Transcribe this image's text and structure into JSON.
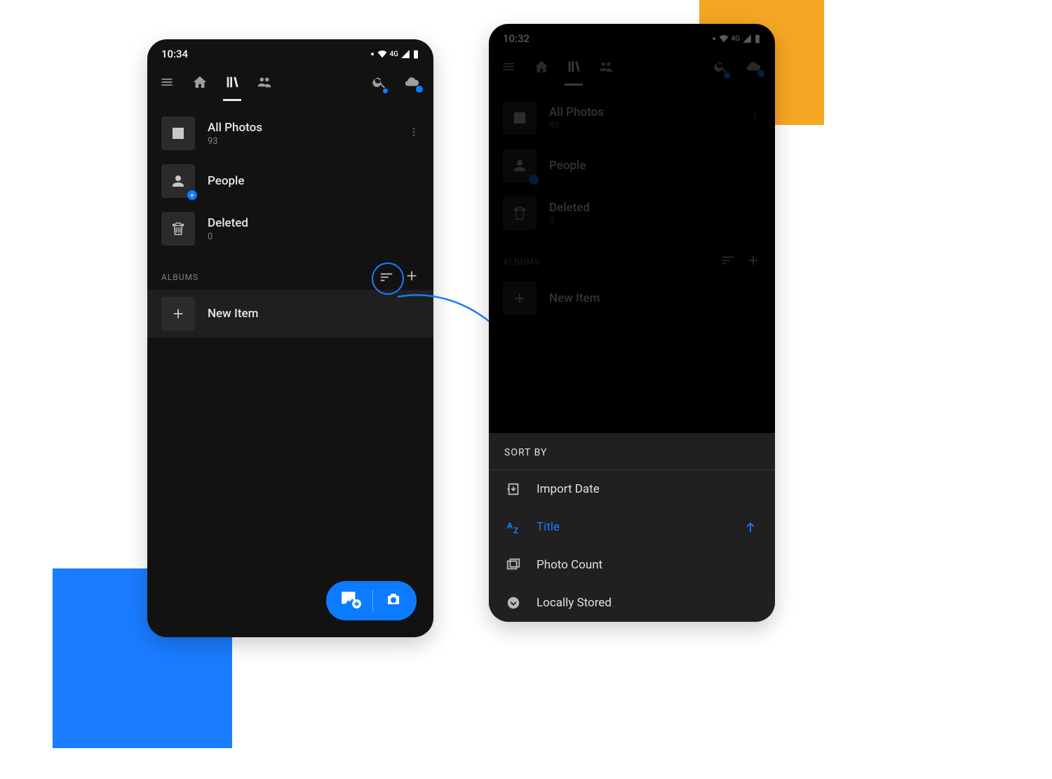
{
  "colors": {
    "accent": "#0d7bff",
    "decoYellow": "#f5a623",
    "decoBlue": "#1a7cff"
  },
  "phone_left": {
    "status": {
      "time": "10:34",
      "network": "4G"
    },
    "library": {
      "all_photos": {
        "title": "All Photos",
        "count": "93"
      },
      "people": {
        "title": "People"
      },
      "deleted": {
        "title": "Deleted",
        "count": "0"
      }
    },
    "section": {
      "title": "ALBUMS"
    },
    "new_item": {
      "label": "New Item"
    }
  },
  "phone_right": {
    "status": {
      "time": "10:32",
      "network": "4G"
    },
    "library": {
      "all_photos": {
        "title": "All Photos",
        "count": "93"
      },
      "people": {
        "title": "People"
      },
      "deleted": {
        "title": "Deleted",
        "count": "0"
      }
    },
    "section": {
      "title": "ALBUMS"
    },
    "new_item": {
      "label": "New Item"
    },
    "sort_panel": {
      "title": "SORT BY",
      "items": [
        {
          "label": "Import Date",
          "icon": "import-icon"
        },
        {
          "label": "Title",
          "icon": "alpha-sort-icon",
          "active": true,
          "ascending": true
        },
        {
          "label": "Photo Count",
          "icon": "gallery-icon"
        },
        {
          "label": "Locally Stored",
          "icon": "chevron-down-circle-icon"
        }
      ]
    }
  }
}
